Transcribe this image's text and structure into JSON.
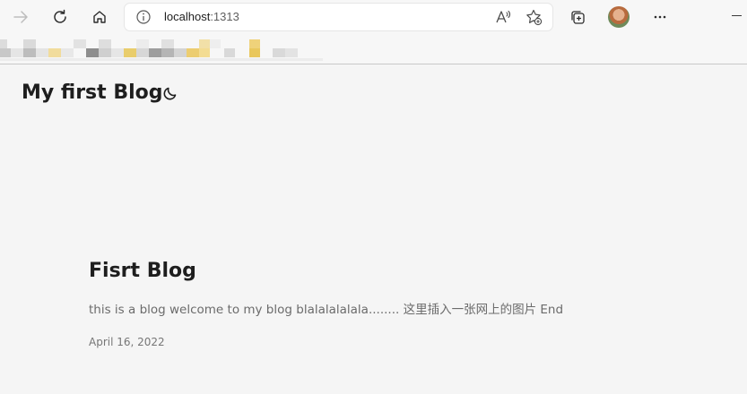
{
  "browser": {
    "address_host": "localhost",
    "address_port": ":1313",
    "icons": {
      "back": "arrow-left-icon",
      "refresh": "refresh-icon",
      "home": "home-icon",
      "site_info": "info-icon",
      "read_aloud": "read-aloud-icon",
      "add_favorite": "star-add-icon",
      "collections": "collections-icon",
      "profile": "avatar",
      "menu": "more-icon",
      "minimize": "minimize-icon"
    }
  },
  "site": {
    "title": "My first Blog",
    "theme_icon": "moon-icon"
  },
  "posts": [
    {
      "title": "Fisrt Blog",
      "summary": "this is a blog welcome to my blog blalalalalala........ 这里插入一张网上的图片 End",
      "date": "April 16, 2022"
    }
  ],
  "colors": {
    "page_background": "#f5f5f5",
    "text_primary": "#1e1e1e",
    "text_secondary": "#6b6b6b"
  }
}
